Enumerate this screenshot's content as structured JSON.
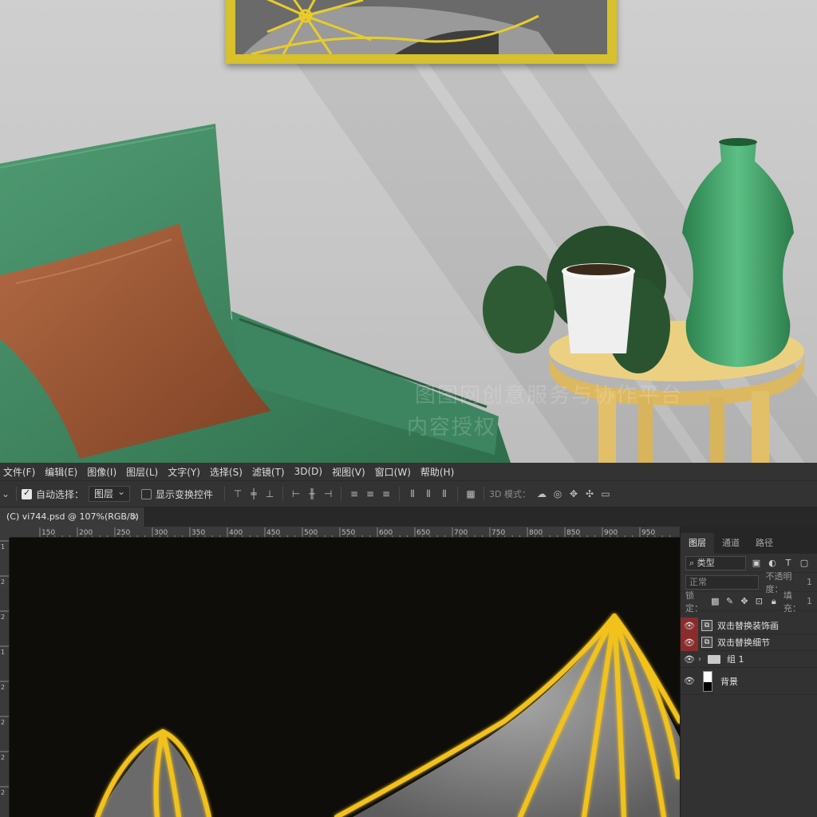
{
  "menubar": {
    "items": [
      "文件(F)",
      "编辑(E)",
      "图像(I)",
      "图层(L)",
      "文字(Y)",
      "选择(S)",
      "滤镜(T)",
      "3D(D)",
      "视图(V)",
      "窗口(W)",
      "帮助(H)"
    ]
  },
  "options": {
    "auto_select_label": "自动选择：",
    "auto_select_checked": true,
    "layer_select_value": "图层",
    "show_transform_label": "显示变换控件",
    "mode_3d_label": "3D 模式："
  },
  "document": {
    "tab_title": "(C) vi744.psd @ 107%(RGB/8) *",
    "close_glyph": "×"
  },
  "ruler": {
    "h_ticks": [
      "150",
      "200",
      "250",
      "300",
      "350",
      "400",
      "450",
      "500",
      "550",
      "600",
      "650",
      "700",
      "750",
      "800",
      "850",
      "900",
      "950"
    ],
    "v_ticks": [
      "1",
      "2",
      "2",
      "1",
      "2",
      "2",
      "2",
      "2",
      "2"
    ]
  },
  "panel": {
    "tabs": [
      "图层",
      "通道",
      "路径"
    ],
    "filter_kind": "类型",
    "blend_mode": "正常",
    "opacity_label": "不透明度：",
    "opacity_value": "1",
    "lock_label": "锁定：",
    "fill_label": "填充：",
    "fill_value": "1",
    "layers": [
      {
        "name": "双击替换装饰画",
        "kind": "smart",
        "visible": true,
        "highlighted": true
      },
      {
        "name": "双击替换细节",
        "kind": "smart",
        "visible": true,
        "highlighted": true
      },
      {
        "name": "组 1",
        "kind": "group",
        "visible": true,
        "highlighted": false
      },
      {
        "name": "背景",
        "kind": "pixel",
        "visible": true,
        "highlighted": false
      }
    ]
  },
  "scene": {
    "watermark_line1": "图图网创意服务与协作平台",
    "watermark_line2": "内容授权"
  },
  "colors": {
    "gold": "#f2c21b",
    "sofa_green": "#3f8a62",
    "pillow_brown": "#9a5634",
    "table_yellow": "#e8c977",
    "vase_green": "#3d9a5e",
    "canvas_bg": "#0f0d0a",
    "layer_highlight": "#8b2c2c"
  }
}
